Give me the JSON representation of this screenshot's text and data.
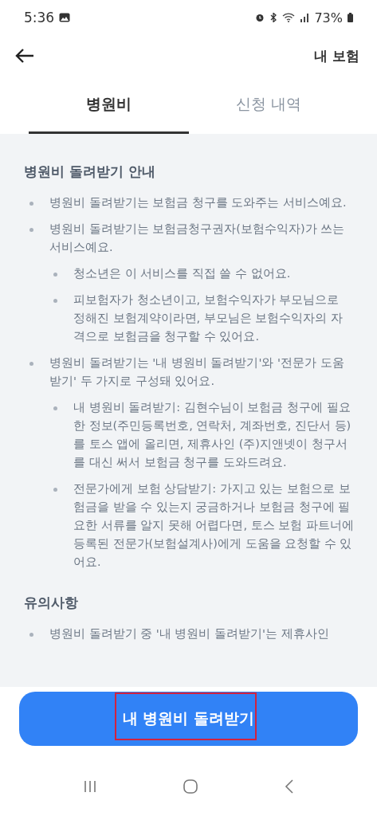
{
  "status_bar": {
    "time": "5:36",
    "battery": "73%"
  },
  "header": {
    "title": "내 보험"
  },
  "tabs": [
    {
      "label": "병원비",
      "selected": true
    },
    {
      "label": "신청 내역",
      "selected": false
    }
  ],
  "sections": [
    {
      "title": "병원비 돌려받기 안내",
      "items": [
        {
          "text": "병원비 돌려받기는 보험금 청구를 도와주는 서비스예요."
        },
        {
          "text": "병원비 돌려받기는 보험금청구권자(보험수익자)가 쓰는 서비스예요.",
          "children": [
            {
              "text": "청소년은 이 서비스를 직접 쓸 수 없어요."
            },
            {
              "text": "피보험자가 청소년이고, 보험수익자가 부모님으로 정해진 보험계약이라면, 부모님은 보험수익자의 자격으로 보험금을 청구할 수 있어요."
            }
          ]
        },
        {
          "text": "병원비 돌려받기는 '내 병원비 돌려받기'와 '전문가 도움받기' 두 가지로 구성돼 있어요.",
          "children": [
            {
              "text": "내 병원비 돌려받기: 김현수님이 보험금 청구에 필요한 정보(주민등록번호, 연락처, 계좌번호, 진단서 등)를 토스 앱에 올리면, 제휴사인 (주)지앤넷이 청구서를 대신 써서 보험금 청구를 도와드려요."
            },
            {
              "text": "전문가에게 보험 상담받기: 가지고 있는 보험으로 보험금을 받을 수 있는지 궁금하거나 보험금 청구에 필요한 서류를 알지 못해 어렵다면, 토스 보험 파트너에 등록된 전문가(보험설계사)에게 도움을 요청할 수 있어요."
            }
          ]
        }
      ]
    },
    {
      "title": "유의사항",
      "items": [
        {
          "text": "병원비 돌려받기 중 '내 병원비 돌려받기'는 제휴사인"
        }
      ]
    }
  ],
  "primary_button": {
    "label": "내 병원비 돌려받기"
  }
}
